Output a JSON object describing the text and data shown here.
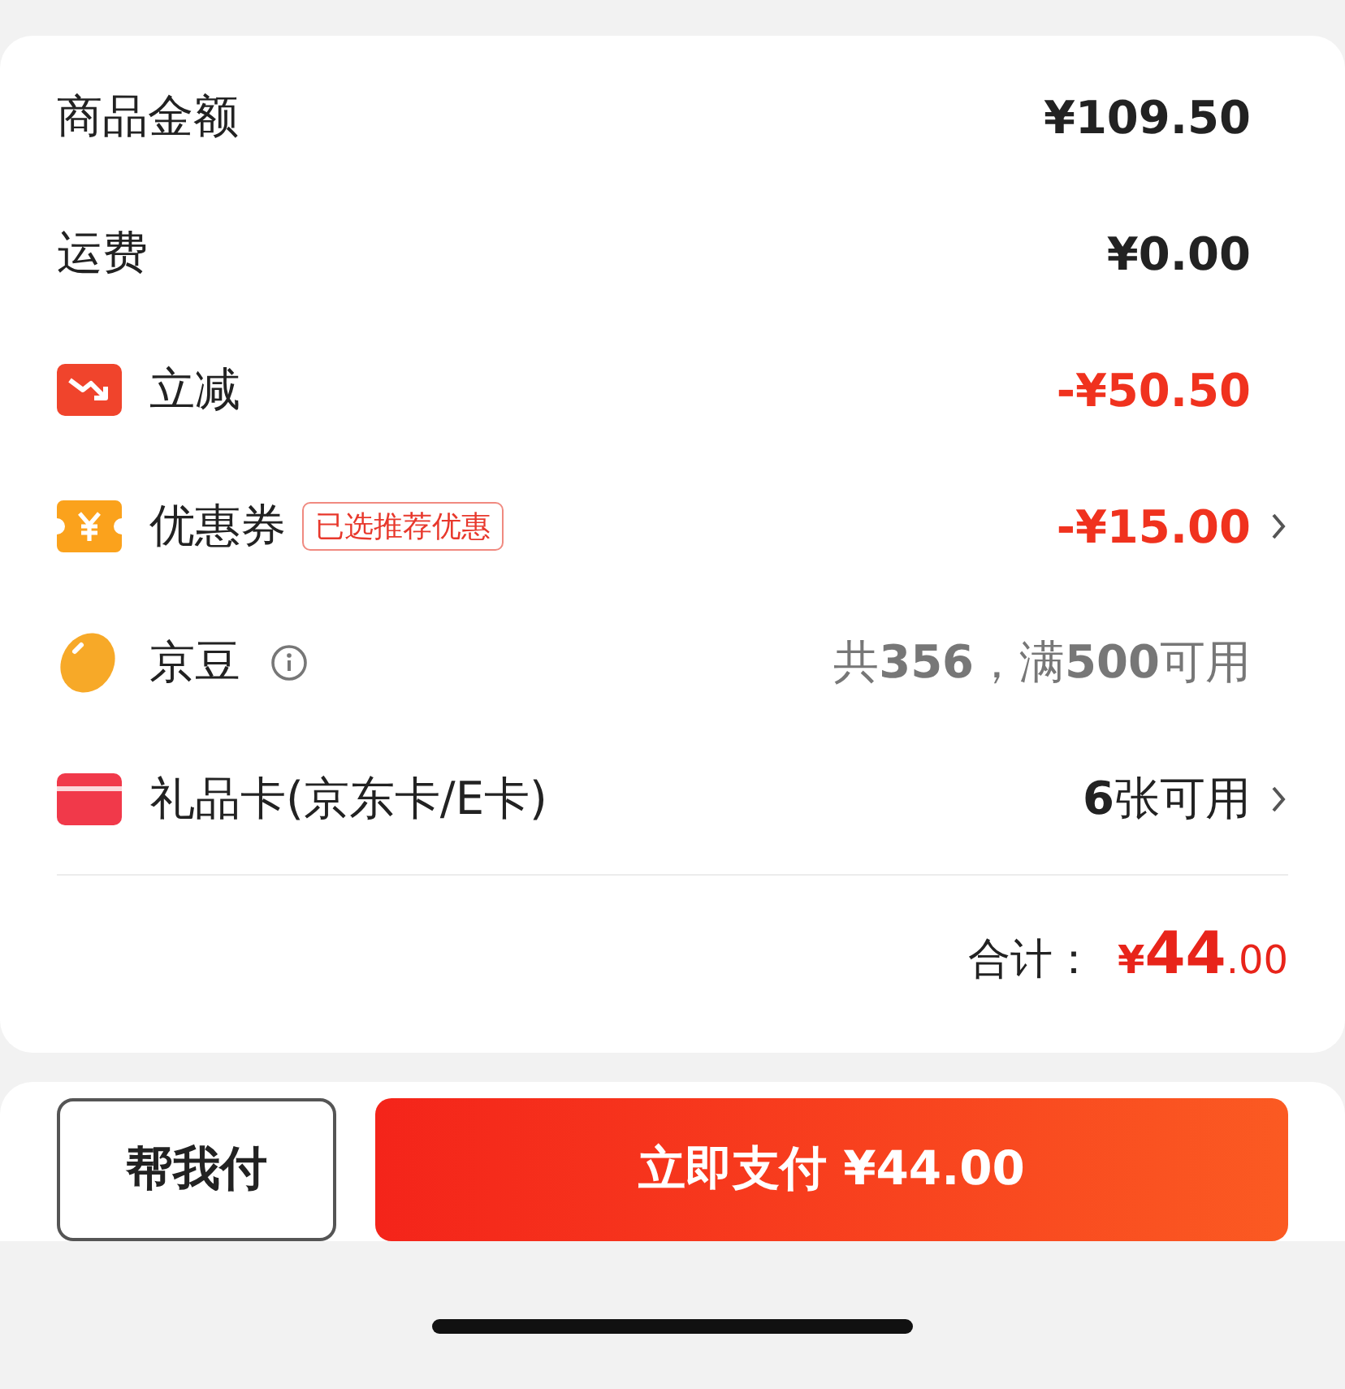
{
  "rows": [
    {
      "label": "商品金额",
      "value": "¥109.50",
      "color": "#222222",
      "arrow": false
    },
    {
      "label": "运费",
      "value": "¥0.00",
      "color": "#222222",
      "arrow": false
    },
    {
      "kind": "discount",
      "label": "立减",
      "value": "-¥50.50",
      "color": "#f0321e",
      "arrow": false
    },
    {
      "kind": "coupon",
      "label": "优惠券",
      "badge": "已选推荐优惠",
      "value": "-¥15.00",
      "color": "#f0321e",
      "arrow": true
    },
    {
      "kind": "bean",
      "label": "京豆",
      "info": true,
      "value": "共**356**，满**500**可用",
      "color": "#777777",
      "arrow": false
    },
    {
      "kind": "giftcard",
      "label": "礼品卡(京东卡/E卡)",
      "value": "**6**张可用",
      "color": "#222222",
      "arrow": true
    }
  ],
  "total": {
    "label": "合计：",
    "currency": "¥",
    "integer": "44",
    "decimal": ".00"
  },
  "buttons": [
    {
      "label": "帮我付",
      "kind": "secondary"
    },
    {
      "label": "立即支付 ¥44.00",
      "kind": "primary"
    }
  ]
}
